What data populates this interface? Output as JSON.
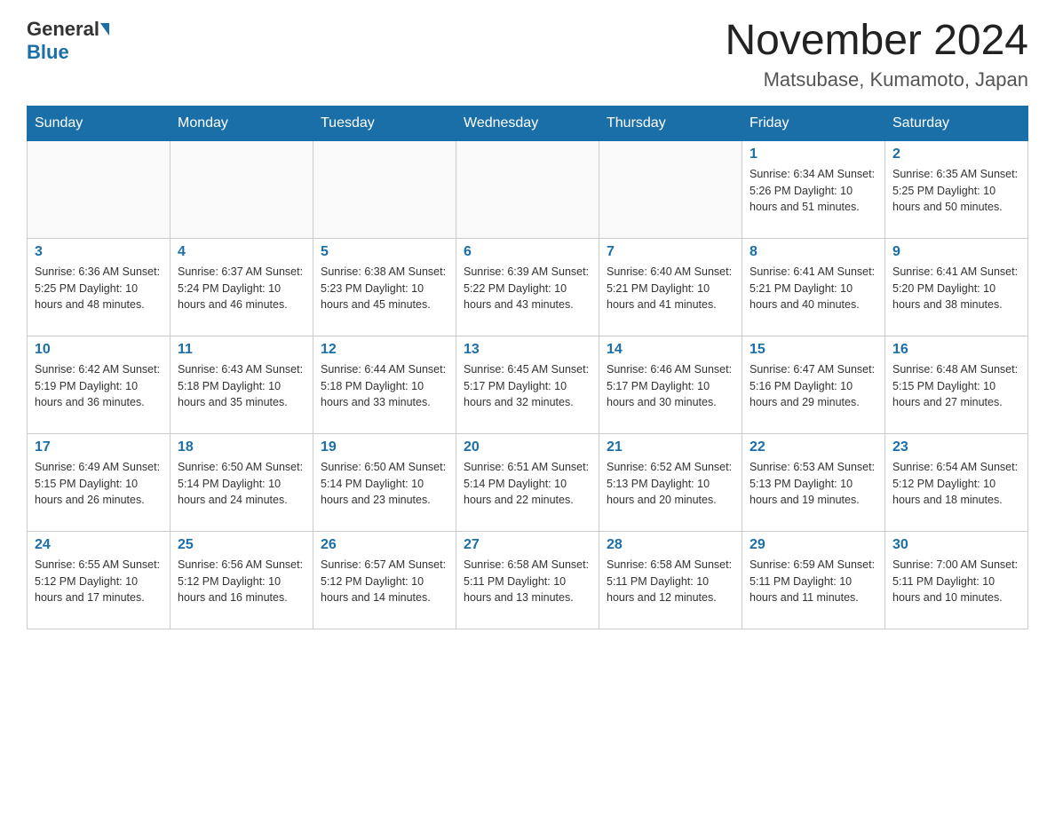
{
  "header": {
    "logo_general": "General",
    "logo_blue": "Blue",
    "month_title": "November 2024",
    "location": "Matsubase, Kumamoto, Japan"
  },
  "days_of_week": [
    "Sunday",
    "Monday",
    "Tuesday",
    "Wednesday",
    "Thursday",
    "Friday",
    "Saturday"
  ],
  "weeks": [
    [
      {
        "day": "",
        "info": ""
      },
      {
        "day": "",
        "info": ""
      },
      {
        "day": "",
        "info": ""
      },
      {
        "day": "",
        "info": ""
      },
      {
        "day": "",
        "info": ""
      },
      {
        "day": "1",
        "info": "Sunrise: 6:34 AM\nSunset: 5:26 PM\nDaylight: 10 hours and 51 minutes."
      },
      {
        "day": "2",
        "info": "Sunrise: 6:35 AM\nSunset: 5:25 PM\nDaylight: 10 hours and 50 minutes."
      }
    ],
    [
      {
        "day": "3",
        "info": "Sunrise: 6:36 AM\nSunset: 5:25 PM\nDaylight: 10 hours and 48 minutes."
      },
      {
        "day": "4",
        "info": "Sunrise: 6:37 AM\nSunset: 5:24 PM\nDaylight: 10 hours and 46 minutes."
      },
      {
        "day": "5",
        "info": "Sunrise: 6:38 AM\nSunset: 5:23 PM\nDaylight: 10 hours and 45 minutes."
      },
      {
        "day": "6",
        "info": "Sunrise: 6:39 AM\nSunset: 5:22 PM\nDaylight: 10 hours and 43 minutes."
      },
      {
        "day": "7",
        "info": "Sunrise: 6:40 AM\nSunset: 5:21 PM\nDaylight: 10 hours and 41 minutes."
      },
      {
        "day": "8",
        "info": "Sunrise: 6:41 AM\nSunset: 5:21 PM\nDaylight: 10 hours and 40 minutes."
      },
      {
        "day": "9",
        "info": "Sunrise: 6:41 AM\nSunset: 5:20 PM\nDaylight: 10 hours and 38 minutes."
      }
    ],
    [
      {
        "day": "10",
        "info": "Sunrise: 6:42 AM\nSunset: 5:19 PM\nDaylight: 10 hours and 36 minutes."
      },
      {
        "day": "11",
        "info": "Sunrise: 6:43 AM\nSunset: 5:18 PM\nDaylight: 10 hours and 35 minutes."
      },
      {
        "day": "12",
        "info": "Sunrise: 6:44 AM\nSunset: 5:18 PM\nDaylight: 10 hours and 33 minutes."
      },
      {
        "day": "13",
        "info": "Sunrise: 6:45 AM\nSunset: 5:17 PM\nDaylight: 10 hours and 32 minutes."
      },
      {
        "day": "14",
        "info": "Sunrise: 6:46 AM\nSunset: 5:17 PM\nDaylight: 10 hours and 30 minutes."
      },
      {
        "day": "15",
        "info": "Sunrise: 6:47 AM\nSunset: 5:16 PM\nDaylight: 10 hours and 29 minutes."
      },
      {
        "day": "16",
        "info": "Sunrise: 6:48 AM\nSunset: 5:15 PM\nDaylight: 10 hours and 27 minutes."
      }
    ],
    [
      {
        "day": "17",
        "info": "Sunrise: 6:49 AM\nSunset: 5:15 PM\nDaylight: 10 hours and 26 minutes."
      },
      {
        "day": "18",
        "info": "Sunrise: 6:50 AM\nSunset: 5:14 PM\nDaylight: 10 hours and 24 minutes."
      },
      {
        "day": "19",
        "info": "Sunrise: 6:50 AM\nSunset: 5:14 PM\nDaylight: 10 hours and 23 minutes."
      },
      {
        "day": "20",
        "info": "Sunrise: 6:51 AM\nSunset: 5:14 PM\nDaylight: 10 hours and 22 minutes."
      },
      {
        "day": "21",
        "info": "Sunrise: 6:52 AM\nSunset: 5:13 PM\nDaylight: 10 hours and 20 minutes."
      },
      {
        "day": "22",
        "info": "Sunrise: 6:53 AM\nSunset: 5:13 PM\nDaylight: 10 hours and 19 minutes."
      },
      {
        "day": "23",
        "info": "Sunrise: 6:54 AM\nSunset: 5:12 PM\nDaylight: 10 hours and 18 minutes."
      }
    ],
    [
      {
        "day": "24",
        "info": "Sunrise: 6:55 AM\nSunset: 5:12 PM\nDaylight: 10 hours and 17 minutes."
      },
      {
        "day": "25",
        "info": "Sunrise: 6:56 AM\nSunset: 5:12 PM\nDaylight: 10 hours and 16 minutes."
      },
      {
        "day": "26",
        "info": "Sunrise: 6:57 AM\nSunset: 5:12 PM\nDaylight: 10 hours and 14 minutes."
      },
      {
        "day": "27",
        "info": "Sunrise: 6:58 AM\nSunset: 5:11 PM\nDaylight: 10 hours and 13 minutes."
      },
      {
        "day": "28",
        "info": "Sunrise: 6:58 AM\nSunset: 5:11 PM\nDaylight: 10 hours and 12 minutes."
      },
      {
        "day": "29",
        "info": "Sunrise: 6:59 AM\nSunset: 5:11 PM\nDaylight: 10 hours and 11 minutes."
      },
      {
        "day": "30",
        "info": "Sunrise: 7:00 AM\nSunset: 5:11 PM\nDaylight: 10 hours and 10 minutes."
      }
    ]
  ]
}
